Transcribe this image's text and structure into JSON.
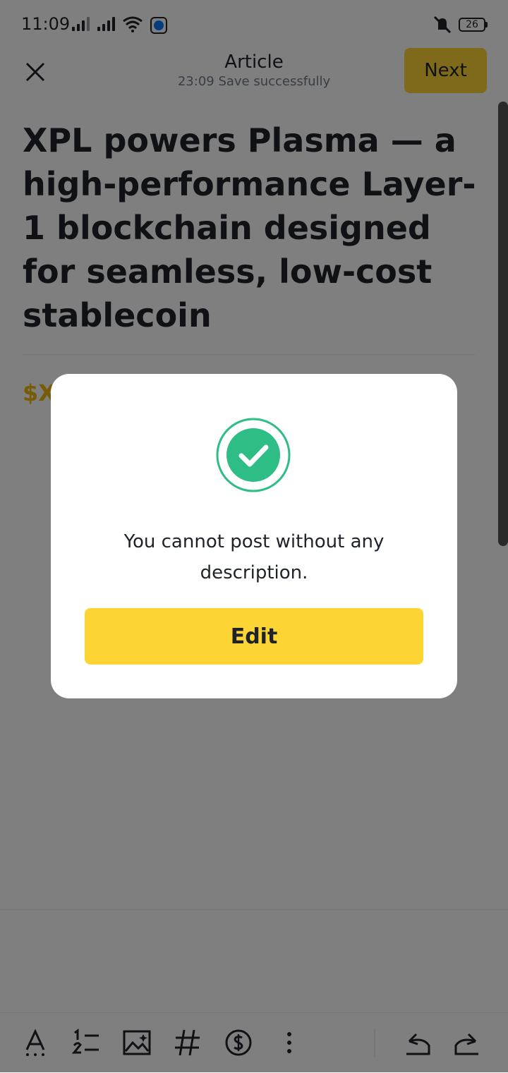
{
  "status_bar": {
    "time": "11:09",
    "battery": "26"
  },
  "header": {
    "title": "Article",
    "subtitle": "23:09 Save successfully",
    "next_label": "Next"
  },
  "article": {
    "title": "XPL powers Plasma — a high-performance Layer-1 blockchain designed for seamless, low-cost stablecoin",
    "tag_text": "$X"
  },
  "modal": {
    "message": "You cannot post without any description.",
    "button_label": "Edit",
    "icon": "check-circle-icon",
    "accent_color": "#2ebd85"
  },
  "toolbar": {
    "items": [
      "text-format-icon",
      "numbered-list-icon",
      "image-icon",
      "hashtag-icon",
      "coin-icon",
      "more-icon",
      "undo-icon",
      "redo-icon"
    ]
  },
  "colors": {
    "brand": "#fcd535",
    "tag": "#f0b90b",
    "text": "#1e2329"
  }
}
